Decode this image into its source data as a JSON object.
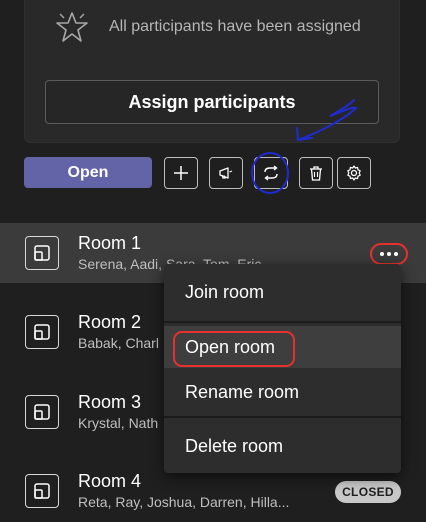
{
  "assign_panel": {
    "status_text": "All participants have been assigned",
    "status_icon": "star-icon",
    "assign_button_label": "Assign participants"
  },
  "toolbar": {
    "open_label": "Open",
    "open_color": "#6264a7",
    "icons": [
      "add-icon",
      "announcement-icon",
      "recreate-icon",
      "delete-icon",
      "settings-icon"
    ]
  },
  "rooms": [
    {
      "name": "Room 1",
      "members": "Serena, Aadi, Sara, Tom, Eric"
    },
    {
      "name": "Room 2",
      "members": "Babak, Charl"
    },
    {
      "name": "Room 3",
      "members": "Krystal, Nath"
    },
    {
      "name": "Room 4",
      "members": "Reta, Ray, Joshua, Darren, Hilla...",
      "status": "CLOSED"
    }
  ],
  "context_menu": {
    "items": [
      "Join room",
      "Open room",
      "Rename room",
      "Delete room"
    ]
  },
  "colors": {
    "background": "#1f1f1f",
    "accent": "#6264a7",
    "annotation_red": "#e5322e",
    "annotation_blue": "#1f2bd1"
  }
}
